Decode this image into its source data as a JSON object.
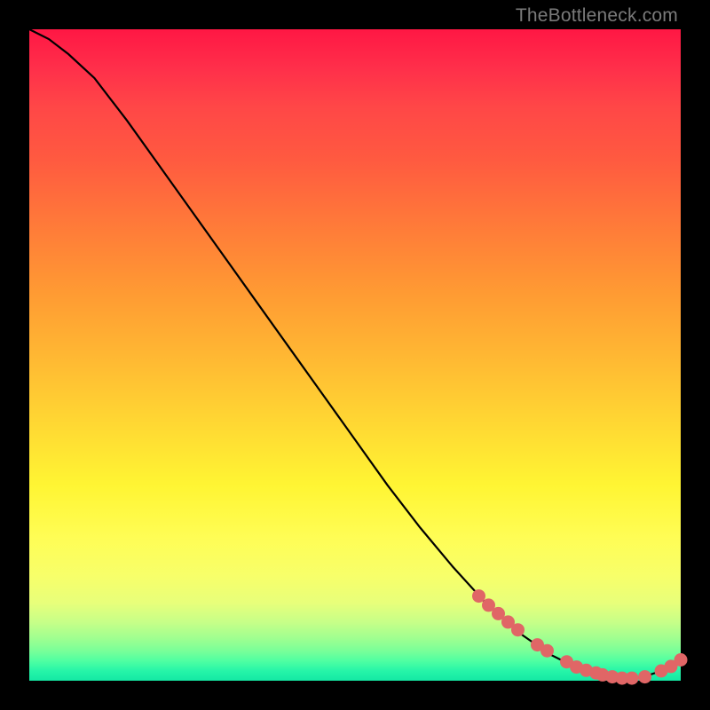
{
  "watermark": "TheBottleneck.com",
  "chart_data": {
    "type": "line",
    "title": "",
    "xlabel": "",
    "ylabel": "",
    "xlim": [
      0,
      100
    ],
    "ylim": [
      0,
      100
    ],
    "series": [
      {
        "name": "curve",
        "x": [
          0,
          3,
          6,
          10,
          15,
          20,
          25,
          30,
          35,
          40,
          45,
          50,
          55,
          60,
          65,
          70,
          75,
          80,
          84,
          88,
          91,
          94,
          97,
          100
        ],
        "y": [
          100,
          98.5,
          96.2,
          92.5,
          86.0,
          79.0,
          72.0,
          65.0,
          58.0,
          51.0,
          44.0,
          37.0,
          30.0,
          23.5,
          17.5,
          12.0,
          7.5,
          4.0,
          2.0,
          0.8,
          0.3,
          0.5,
          1.5,
          3.2
        ]
      }
    ],
    "markers": {
      "name": "points",
      "color": "#e06666",
      "x": [
        69,
        70.5,
        72,
        73.5,
        75,
        78,
        79.5,
        82.5,
        84,
        85.5,
        87,
        88,
        89.5,
        91,
        92.5,
        94.5,
        97,
        98.5,
        100
      ],
      "y": [
        13.0,
        11.6,
        10.3,
        9.0,
        7.8,
        5.5,
        4.6,
        2.9,
        2.1,
        1.6,
        1.2,
        0.9,
        0.6,
        0.4,
        0.4,
        0.6,
        1.5,
        2.2,
        3.2
      ]
    }
  }
}
